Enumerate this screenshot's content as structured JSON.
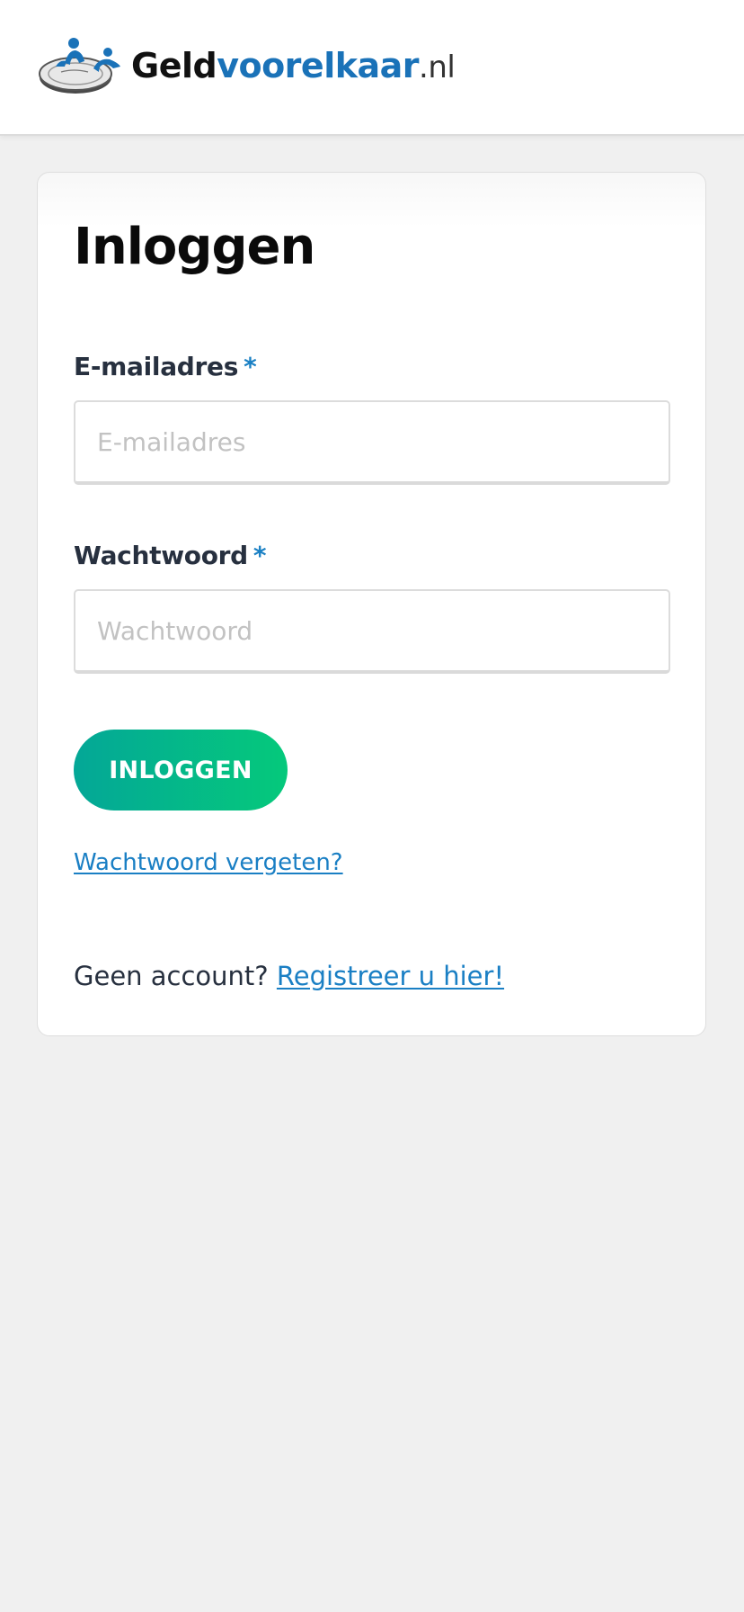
{
  "header": {
    "logo": {
      "part_geld": "Geld",
      "part_voorelkaar": "voorelkaar",
      "part_tld": ".nl",
      "icon": "people-on-coin-logo-icon"
    }
  },
  "login_form": {
    "title": "Inloggen",
    "email": {
      "label": "E-mailadres",
      "required_marker": "*",
      "value": "",
      "placeholder": "E-mailadres"
    },
    "password": {
      "label": "Wachtwoord",
      "required_marker": "*",
      "value": "",
      "placeholder": "Wachtwoord"
    },
    "submit_label": "INLOGGEN",
    "forgot_link": "Wachtwoord vergeten?",
    "register_prompt": "Geen account?",
    "register_link": "Registreer u hier!"
  },
  "colors": {
    "brand_blue": "#1a72b8",
    "link_blue": "#1a7fc4",
    "button_gradient_start": "#04a797",
    "button_gradient_end": "#05c97b",
    "page_background": "#f0f0f0"
  }
}
